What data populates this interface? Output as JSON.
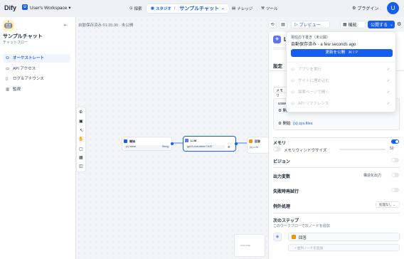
{
  "topbar": {
    "logo": "Dify",
    "workspace_initial": "U",
    "workspace_name": "User's Workspace",
    "nav": [
      "探索",
      "スタジオ",
      "ナレッジ",
      "ツール"
    ],
    "app_title": "サンプルチャット",
    "plugin_label": "プラグイン",
    "avatar_initial": "U"
  },
  "sidebar": {
    "app_name": "サンプルチャット",
    "app_type": "チャットフロー",
    "items": [
      {
        "label": "オーケストレート"
      },
      {
        "label": "API アクセス"
      },
      {
        "label": "ログ＆アナウンス"
      },
      {
        "label": "監視"
      }
    ]
  },
  "canvas": {
    "autosave_status": "自動保存済み 01:35:30 · 未公開",
    "nodes": [
      {
        "title": "開始",
        "detail": "(x) name",
        "tag": "String"
      },
      {
        "title": "LLM",
        "detail": "gpt-5-chat-latest CHAT"
      },
      {
        "title": "回答",
        "detail": "{x} LLM"
      }
    ],
    "minimap_label": "mini map"
  },
  "toolbar": {
    "preview": "プレビュー",
    "features": "機能",
    "publish": "公開する"
  },
  "popup": {
    "draft_label": "現在の下書き（未公開）",
    "saved_text": "自動保存済み · a few seconds ago",
    "update_button": "更新を公開",
    "shortcut": "⌘⇧P",
    "menu": [
      "アプリを実行",
      "サイトに埋め込む",
      "探索ページで開く",
      "API リファレンス"
    ]
  },
  "panel": {
    "node_initial": "L",
    "tab_settings": "設定",
    "memory_tag": "メモリ",
    "user_label": "USER",
    "user_var1": "開始",
    "user_var2": "{x} sys.files",
    "memory": "メモリ",
    "memory_window": "メモリウィンドウサイズ",
    "memory_window_value": "50",
    "vision": "ビジョン",
    "output_vars": "出力変数",
    "structured_output": "構造化出力",
    "retry": "失敗時再試行",
    "exception": "例外処理",
    "exception_value": "処理なし",
    "next_step": "次のステップ",
    "next_step_desc": "このワークフローで次ノードを追加",
    "next_node": "回答",
    "add_node": "+ 並列ノードを追加"
  },
  "colors": {
    "accent": "#155eef",
    "sidebar_active_bg": "#eff4ff"
  }
}
